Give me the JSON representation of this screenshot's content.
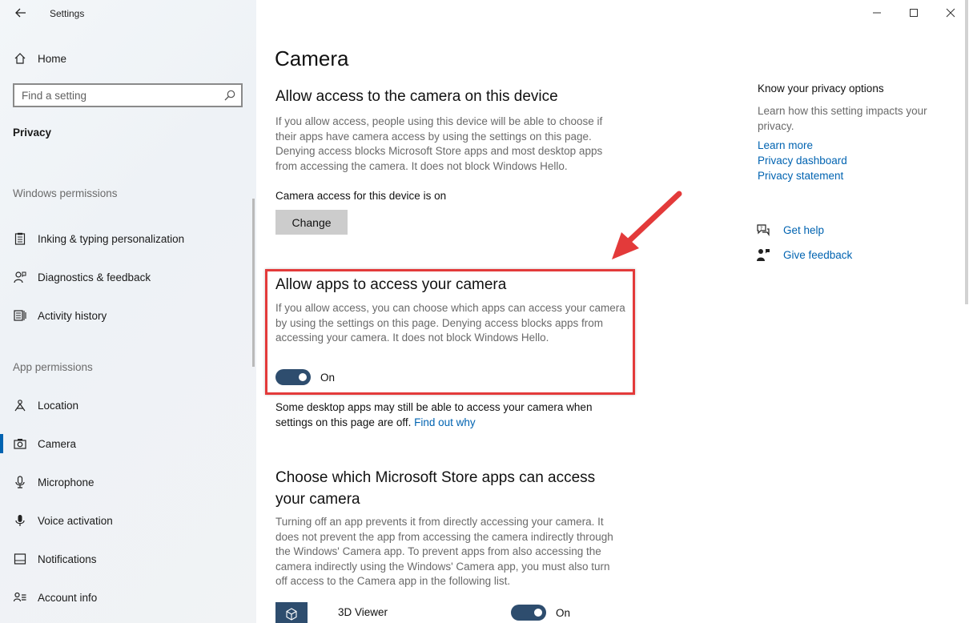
{
  "window": {
    "app_title": "Settings",
    "controls": [
      "minimize",
      "maximize",
      "close"
    ]
  },
  "sidebar": {
    "home_label": "Home",
    "search_placeholder": "Find a setting",
    "category_title": "Privacy",
    "windows_permissions_header": "Windows permissions",
    "windows_permissions": [
      {
        "label": "Inking & typing personalization",
        "icon": "clipboard-icon"
      },
      {
        "label": "Diagnostics & feedback",
        "icon": "person-feedback-icon"
      },
      {
        "label": "Activity history",
        "icon": "activity-history-icon"
      }
    ],
    "app_permissions_header": "App permissions",
    "app_permissions": [
      {
        "label": "Location",
        "icon": "location-icon"
      },
      {
        "label": "Camera",
        "icon": "camera-icon",
        "selected": true
      },
      {
        "label": "Microphone",
        "icon": "microphone-icon"
      },
      {
        "label": "Voice activation",
        "icon": "voice-activation-icon"
      },
      {
        "label": "Notifications",
        "icon": "notifications-icon"
      },
      {
        "label": "Account info",
        "icon": "account-info-icon"
      }
    ]
  },
  "main": {
    "page_title": "Camera",
    "device_access": {
      "heading": "Allow access to the camera on this device",
      "description_lines": [
        "If you allow access, people using this device will be able to choose if",
        "their apps have camera access by using the settings on this page.",
        "Denying access blocks Microsoft Store apps and most desktop apps",
        "from accessing the camera. It does not block Windows Hello."
      ],
      "status": "Camera access for this device is on",
      "change_button": "Change"
    },
    "apps_access": {
      "heading": "Allow apps to access your camera",
      "description_lines": [
        "If you allow access, you can choose which apps can access your camera",
        "by using the settings on this page. Denying access blocks apps from",
        "accessing your camera. It does not block Windows Hello."
      ],
      "toggle_state": "On",
      "note_line1": "Some desktop apps may still be able to access your camera when",
      "note_line2": "settings on this page are off.",
      "note_link": "Find out why"
    },
    "store_apps": {
      "heading_line1": "Choose which Microsoft Store apps can access",
      "heading_line2": "your camera",
      "description_lines": [
        "Turning off an app prevents it from directly accessing your camera. It",
        "does not prevent the app from accessing the camera indirectly through",
        "the Windows' Camera app. To prevent apps from also accessing the",
        "camera indirectly using the Windows' Camera app, you must also turn",
        "off access to the Camera app in the following list."
      ],
      "apps": [
        {
          "name": "3D Viewer",
          "toggle_state": "On",
          "icon": "cube-icon"
        }
      ]
    }
  },
  "right_pane": {
    "title": "Know your privacy options",
    "description_line1": "Learn how this setting impacts your",
    "description_line2": "privacy.",
    "links": [
      "Learn more",
      "Privacy dashboard",
      "Privacy statement"
    ],
    "help": [
      {
        "label": "Get help",
        "icon": "help-chat-icon"
      },
      {
        "label": "Give feedback",
        "icon": "feedback-person-icon"
      }
    ]
  },
  "colors": {
    "accent": "#0063b1",
    "toggle_on": "#2e4d6e",
    "annotation_red": "#e33a3a"
  }
}
